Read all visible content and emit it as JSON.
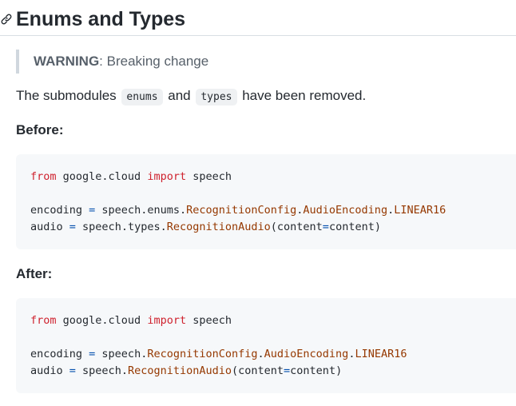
{
  "heading": {
    "title": "Enums and Types",
    "anchor_icon": "link-icon"
  },
  "warning": {
    "label": "WARNING",
    "separator": ":",
    "text": " Breaking change"
  },
  "intro": {
    "prefix": "The submodules ",
    "code1": "enums",
    "middle": " and ",
    "code2": "types",
    "suffix": " have been removed."
  },
  "before": {
    "title": "Before:",
    "line1": {
      "kw1": "from",
      "mod": " google.cloud ",
      "kw2": "import",
      "name": " speech"
    },
    "line2": {
      "var": "encoding ",
      "op": "=",
      "path": " speech.enums.",
      "a": "RecognitionConfig",
      "d1": ".",
      "b": "AudioEncoding",
      "d2": ".",
      "c": "LINEAR16"
    },
    "line3": {
      "var": "audio ",
      "op": "=",
      "path": " speech.types.",
      "a": "RecognitionAudio",
      "args": "(content",
      "eq": "=",
      "rest": "content)"
    }
  },
  "after": {
    "title": "After:",
    "line1": {
      "kw1": "from",
      "mod": " google.cloud ",
      "kw2": "import",
      "name": " speech"
    },
    "line2": {
      "var": "encoding ",
      "op": "=",
      "path": " speech.",
      "a": "RecognitionConfig",
      "d1": ".",
      "b": "AudioEncoding",
      "d2": ".",
      "c": "LINEAR16"
    },
    "line3": {
      "var": "audio ",
      "op": "=",
      "path": " speech.",
      "a": "RecognitionAudio",
      "args": "(content",
      "eq": "=",
      "rest": "content)"
    }
  },
  "colors": {
    "keyword": "#cf222e",
    "name": "#953800",
    "operator": "#0550ae",
    "code_bg": "#f6f8fa"
  }
}
